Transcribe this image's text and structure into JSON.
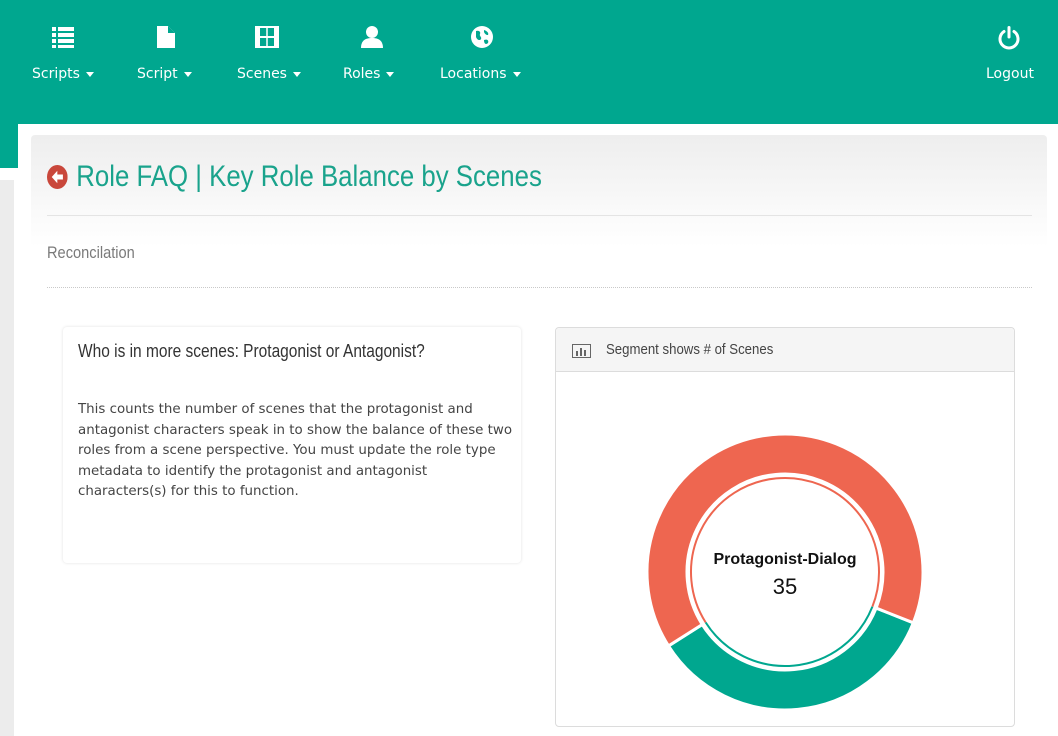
{
  "nav": {
    "items": [
      {
        "label": "Scripts",
        "icon": "list-icon"
      },
      {
        "label": "Script",
        "icon": "document-icon"
      },
      {
        "label": "Scenes",
        "icon": "film-icon"
      },
      {
        "label": "Roles",
        "icon": "user-icon"
      },
      {
        "label": "Locations",
        "icon": "globe-icon"
      }
    ],
    "logout": {
      "label": "Logout",
      "icon": "power-icon"
    }
  },
  "page": {
    "title": "Role FAQ | Key Role Balance by Scenes",
    "subtitle": "Reconcilation"
  },
  "faq": {
    "question": "Who is in more scenes: Protagonist or Antagonist?",
    "answer": "This counts the number of scenes that the protagonist and antagonist characters speak in to show the balance of these two roles from a scene perspective. You must update the role type metadata to identify the protagonist and antagonist characters(s) for this to function."
  },
  "chart_panel": {
    "title": "Segment shows # of Scenes",
    "icon": "bar-chart-icon"
  },
  "chart_data": {
    "type": "pie",
    "segments": [
      {
        "name": "Protagonist-Dialog",
        "value": 35,
        "color": "#00a78f"
      },
      {
        "value": 65,
        "color": "#ee6650"
      }
    ],
    "center": {
      "label": "Protagonist-Dialog",
      "value": "35"
    }
  },
  "colors": {
    "brand": "#00a78f",
    "title": "#1aa38c",
    "back_icon": "#c9473b"
  }
}
